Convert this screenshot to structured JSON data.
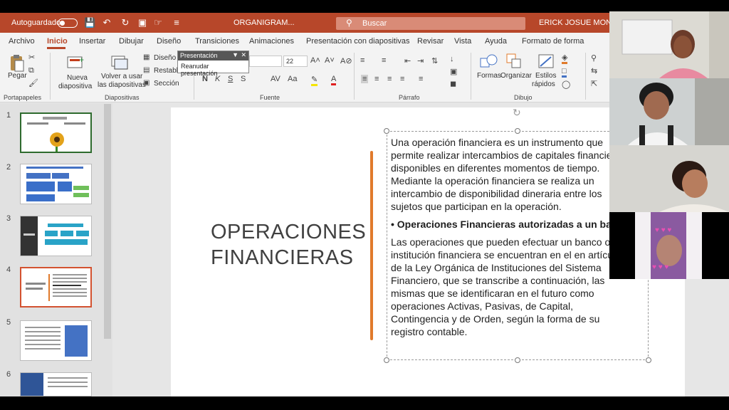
{
  "titlebar": {
    "autosave_label": "Autoguardado",
    "doc_title": "ORGANIGRAM...",
    "search_placeholder": "Buscar",
    "user": "ERICK JOSUE MONTES Q"
  },
  "menu": {
    "items": [
      "Archivo",
      "Inicio",
      "Insertar",
      "Dibujar",
      "Diseño",
      "Transiciones",
      "Animaciones",
      "Presentación con diapositivas",
      "Revisar",
      "Vista",
      "Ayuda",
      "Formato de forma"
    ],
    "active": "Inicio"
  },
  "ribbon": {
    "paste": "Pegar",
    "new_slide_1": "Nueva",
    "new_slide_2": "diapositiva",
    "reuse_1": "Volver a usar",
    "reuse_2": "las diapositivas",
    "layout": "Diseño",
    "reset": "Restable",
    "section": "Sección",
    "font_size": "22",
    "shapes": "Formas",
    "arrange": "Organizar",
    "styles_1": "Estilos",
    "styles_2": "rápidos",
    "groups": [
      "Portapapeles",
      "Diapositivas",
      "Fuente",
      "Párrafo",
      "Dibujo"
    ]
  },
  "popup": {
    "header": "Presentación",
    "item": "Reanudar presentación"
  },
  "thumbnails": [
    "1",
    "2",
    "3",
    "4",
    "5",
    "6"
  ],
  "selected_slide": 4,
  "slide": {
    "title_line1": "OPERACIONES",
    "title_line2": "FINANCIERAS",
    "para1": "Una operación financiera es un instrumento que permite realizar intercambios de capitales financieros disponibles en diferentes momentos de tiempo. Mediante la operación financiera se realiza un intercambio de disponibilidad dineraria entre los sujetos que participan en la operación.",
    "bullet": "Operaciones Financieras autorizadas a un banco",
    "para2": "Las operaciones que pueden efectuar un banco o institución financiera se encuentran en el en artículo de la Ley Orgánica de Instituciones del Sistema Financiero, que se transcribe a continuación, las mismas que se identificaran en el futuro como operaciones Activas, Pasivas, de Capital, Contingencia y de Orden, según la forma de su registro contable."
  },
  "colors": {
    "accent": "#b7472a",
    "orange_bar": "#e07a2b",
    "selected_thumb_border": "#d35230"
  }
}
